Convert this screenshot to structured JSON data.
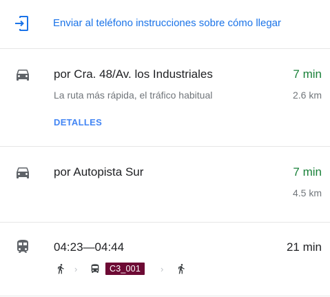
{
  "send_to_phone": {
    "label": "Enviar al teléfono instrucciones sobre cómo llegar",
    "icon": "send-to-phone-icon",
    "color": "#1a73e8"
  },
  "routes": [
    {
      "mode_icon": "car-icon",
      "title": "por Cra. 48/Av. los Industriales",
      "duration": "7 min",
      "duration_color": "#188038",
      "subtitle": "La ruta más rápida, el tráfico habitual",
      "distance": "2.6 km",
      "details_label": "DETALLES"
    },
    {
      "mode_icon": "car-icon",
      "title": "por Autopista Sur",
      "duration": "7 min",
      "duration_color": "#188038",
      "distance": "4.5 km"
    },
    {
      "mode_icon": "train-icon",
      "title": "04:23—04:44",
      "duration": "21 min",
      "duration_color": "#202124",
      "steps": [
        {
          "icon": "walk-icon"
        },
        {
          "icon": "bus-icon",
          "line": "C3_001",
          "line_color": "#6d0a34"
        },
        {
          "icon": "walk-icon"
        }
      ]
    }
  ]
}
